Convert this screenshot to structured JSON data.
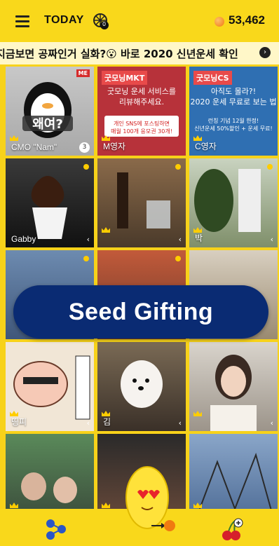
{
  "header": {
    "title": "TODAY",
    "balance": "53,462",
    "wheel_badge": "0"
  },
  "ticker": {
    "text": "지금보면 공짜인거 실화?😮 바로 2020 신년운세 확인"
  },
  "tiles": [
    {
      "label": "CMO \"Nam\"",
      "badge": "ME",
      "count": "3"
    },
    {
      "label": "M영자",
      "tag": "굿모닝MKT",
      "title": "굿모닝 운세 서비스를\n리뷰해주세요.",
      "sub": "개인 SNS에 포스팅하면\n매월 100개 응모권 30개!"
    },
    {
      "label": "C영자",
      "tag": "굿모닝CS",
      "title": "아직도 몰라?!\n2020 운세 무료로 보는 법",
      "sub": "런칭 기념 12월 한정!\n신년운세 50%할인 + 운세 무료!"
    },
    {
      "label": "Gabby"
    },
    {
      "label": ""
    },
    {
      "label": "박"
    },
    {
      "label": ""
    },
    {
      "label": ""
    },
    {
      "label": ""
    },
    {
      "label": "띵피"
    },
    {
      "label": "김"
    },
    {
      "label": ""
    },
    {
      "label": ""
    },
    {
      "label": ""
    },
    {
      "label": ""
    }
  ],
  "banner": {
    "text": "Seed Gifting"
  },
  "icons": {
    "menu": "hamburger-menu-icon",
    "wheel": "roulette-wheel-icon",
    "coin": "seed-coin-icon",
    "ticker_arrow": "chevron-right-icon",
    "left_nav": "friends-network-icon",
    "center": "lemon-mascot-icon",
    "right_nav": "cherry-add-icon"
  },
  "colors": {
    "header": "#f9d81b",
    "banner": "#0a2b73",
    "accent": "#f07a10"
  }
}
